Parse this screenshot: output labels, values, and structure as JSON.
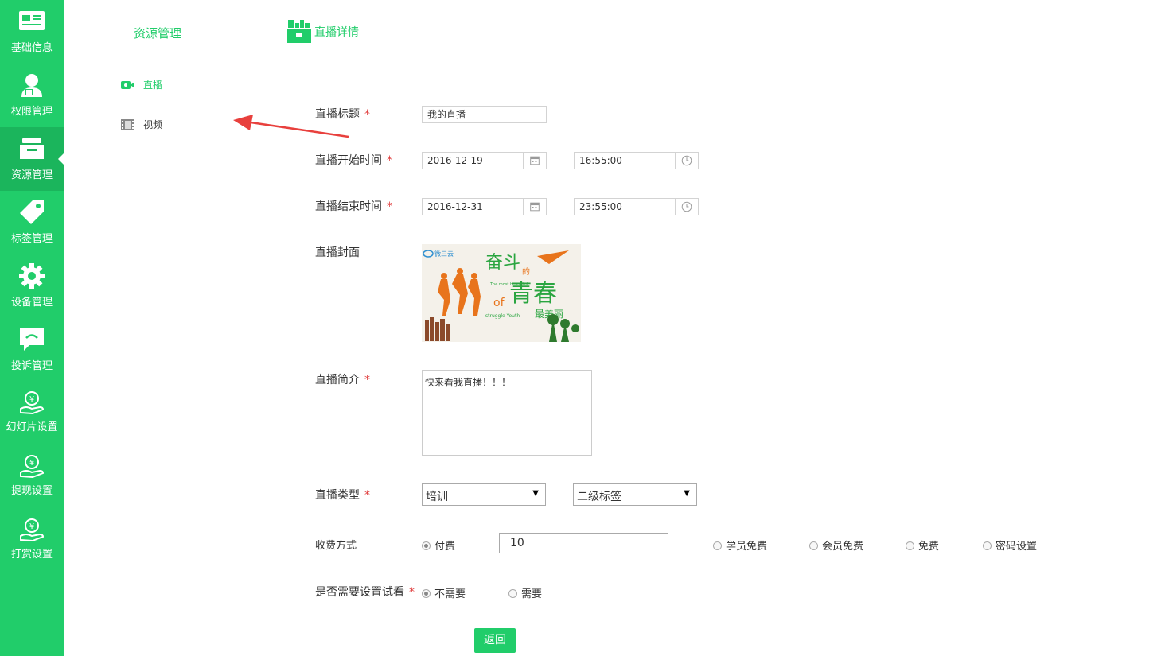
{
  "rail": {
    "items": [
      {
        "label": "基础信息",
        "icon": "id-card-icon"
      },
      {
        "label": "权限管理",
        "icon": "user-lock-icon"
      },
      {
        "label": "资源管理",
        "icon": "inbox-icon",
        "active": true
      },
      {
        "label": "标签管理",
        "icon": "tag-icon"
      },
      {
        "label": "设备管理",
        "icon": "gear-icon"
      },
      {
        "label": "投诉管理",
        "icon": "chat-bubble-icon"
      },
      {
        "label": "幻灯片设置",
        "icon": "money-hand-icon"
      },
      {
        "label": "提现设置",
        "icon": "money-hand-icon"
      },
      {
        "label": "打赏设置",
        "icon": "money-hand-icon"
      }
    ]
  },
  "sidebar": {
    "title": "资源管理",
    "items": [
      {
        "label": "直播",
        "icon": "camera-icon",
        "active": true
      },
      {
        "label": "视频",
        "icon": "film-icon",
        "active": false
      }
    ]
  },
  "header": {
    "title": "直播详情",
    "icon": "live-shop-icon"
  },
  "form": {
    "title_label": "直播标题",
    "title_value": "我的直播",
    "start_label": "直播开始时间",
    "start_date": "2016-12-19",
    "start_time": "16:55:00",
    "end_label": "直播结束时间",
    "end_date": "2016-12-31",
    "end_time": "23:55:00",
    "cover_label": "直播封面",
    "intro_label": "直播简介",
    "intro_value": "快来看我直播！！！",
    "type_label": "直播类型",
    "type_value": "培训",
    "tag_value": "二级标签",
    "fee_label": "收费方式",
    "fee_options": [
      {
        "label": "付费",
        "checked": true
      },
      {
        "label": "学员免费",
        "checked": false
      },
      {
        "label": "会员免费",
        "checked": false
      },
      {
        "label": "免费",
        "checked": false
      },
      {
        "label": "密码设置",
        "checked": false
      }
    ],
    "price_value": "10",
    "trial_label": "是否需要设置试看",
    "trial_options": [
      {
        "label": "不需要",
        "checked": true
      },
      {
        "label": "需要",
        "checked": false
      }
    ],
    "required_mark": "*",
    "back_button": "返回"
  },
  "cover_image": {
    "brand": "微三云",
    "headline_1": "奋斗",
    "headline_2": "的",
    "headline_3": "青春",
    "headline_4": "最美丽",
    "en_1": "The most beautiful",
    "en_2": "of",
    "en_3": "struggle Youth"
  },
  "colors": {
    "brand": "#21cd6a",
    "brand_dark": "#1bb55c",
    "required": "#e03b3b",
    "arrow": "#e8403d"
  }
}
